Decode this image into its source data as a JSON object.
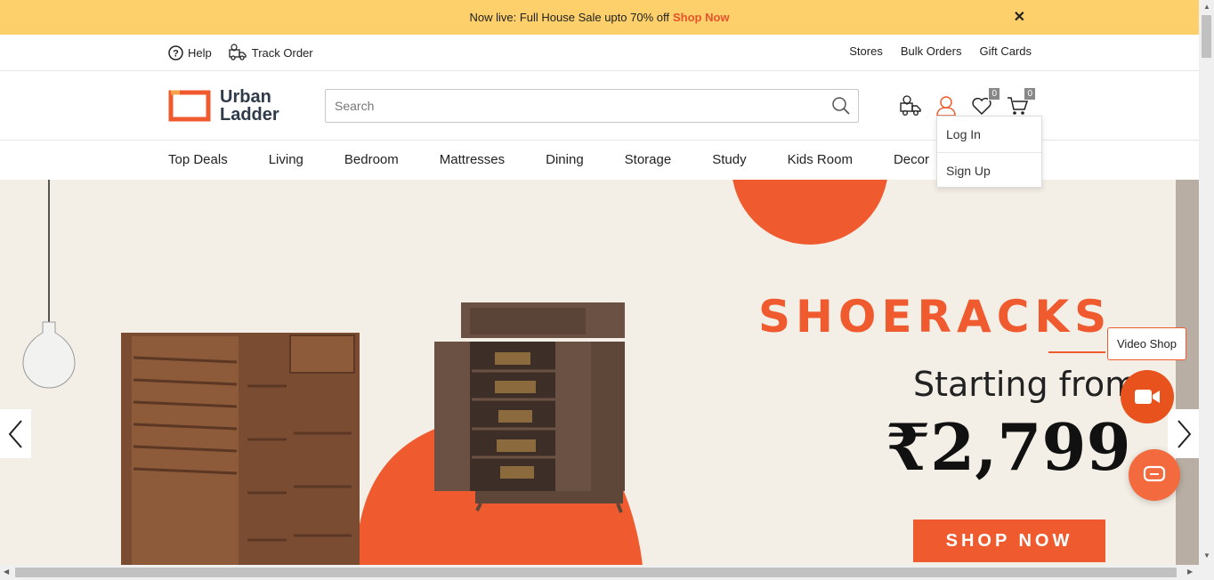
{
  "promo": {
    "text": "Now live: Full House Sale upto 70% off",
    "link": "Shop Now",
    "close": "✕"
  },
  "utility": {
    "help": "Help",
    "track_order": "Track Order",
    "right_links": [
      "Stores",
      "Bulk Orders",
      "Gift Cards"
    ]
  },
  "header": {
    "logo_line1": "Urban",
    "logo_line2": "Ladder",
    "search_placeholder": "Search",
    "wishlist_count": "0",
    "cart_count": "0"
  },
  "nav": [
    "Top Deals",
    "Living",
    "Bedroom",
    "Mattresses",
    "Dining",
    "Storage",
    "Study",
    "Kids Room",
    "Decor"
  ],
  "account_dropdown": [
    "Log In",
    "Sign Up"
  ],
  "hero": {
    "title": "SHOERACKS",
    "subtitle": "Starting from",
    "price": "₹2,799",
    "cta": "SHOP NOW"
  },
  "floating": {
    "video_tip": "Video Shop"
  },
  "colors": {
    "accent": "#ef5b2f",
    "promo_bg": "#fdd06b",
    "hero_bg": "#f4efe6"
  }
}
